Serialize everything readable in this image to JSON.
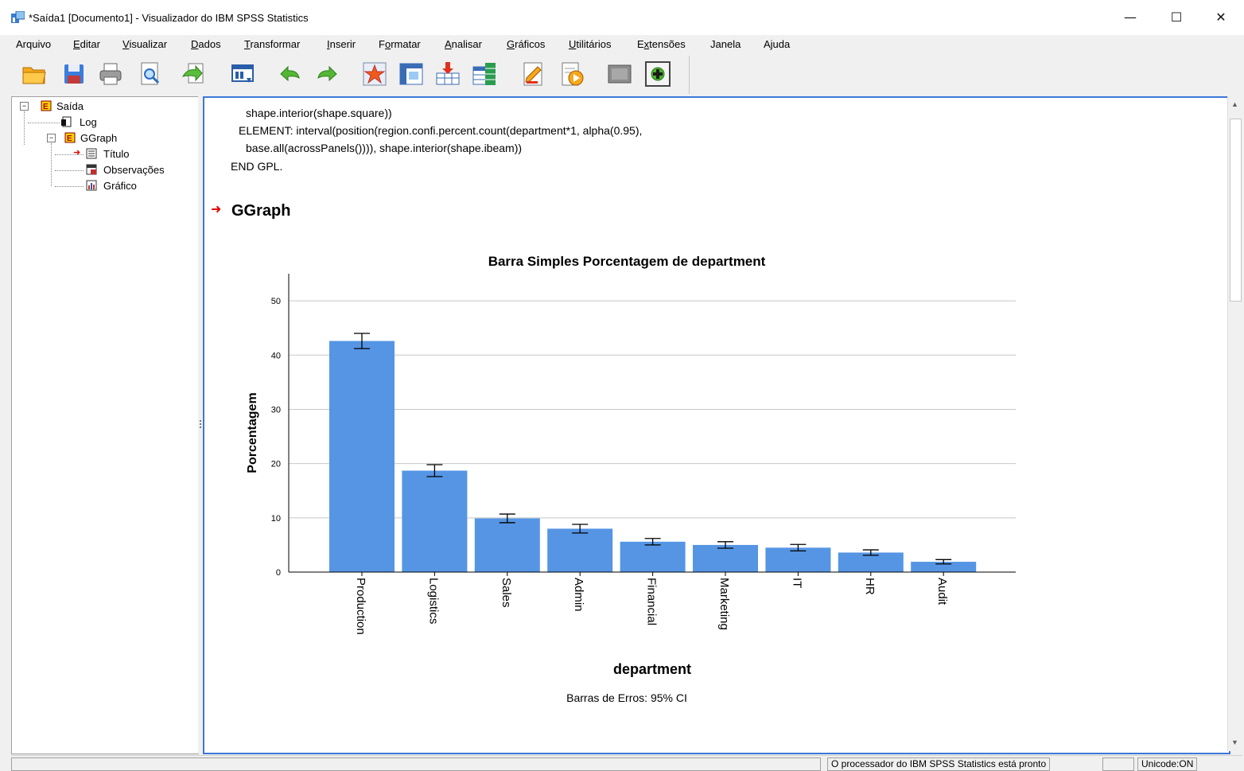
{
  "window": {
    "title": "*Saída1 [Documento1] - Visualizador do IBM SPSS Statistics",
    "minimize_glyph": "—",
    "maximize_glyph": "☐",
    "close_glyph": "✕"
  },
  "menu": [
    {
      "label": "Arquivo",
      "accel": ""
    },
    {
      "label": "Editar",
      "accel": "E"
    },
    {
      "label": "Visualizar",
      "accel": "V"
    },
    {
      "label": "Dados",
      "accel": "D"
    },
    {
      "label": "Transformar",
      "accel": "T"
    },
    {
      "label": "Inserir",
      "accel": "I"
    },
    {
      "label": "Formatar",
      "accel": "o"
    },
    {
      "label": "Analisar",
      "accel": "A"
    },
    {
      "label": "Gráficos",
      "accel": "G"
    },
    {
      "label": "Utilitários",
      "accel": "U"
    },
    {
      "label": "Extensões",
      "accel": "x"
    },
    {
      "label": "Janela",
      "accel": ""
    },
    {
      "label": "Ajuda",
      "accel": ""
    }
  ],
  "toolbar": [
    "open-folder-icon",
    "save-icon",
    "print-icon",
    "print-preview-icon",
    "export-icon",
    "recall-dialog-icon",
    "undo-icon",
    "redo-icon",
    "goto-data-icon",
    "goto-case-icon",
    "goto-variable-icon",
    "variables-icon",
    "designate-window-icon",
    "script-icon",
    "hidden-item-icon",
    "new-item-icon"
  ],
  "outline": {
    "root": "Saída",
    "log": "Log",
    "ggraph": "GGraph",
    "titulo": "Título",
    "observacoes": "Observações",
    "grafico": "Gráfico"
  },
  "content": {
    "syntax_lines": [
      "shape.interior(shape.square))",
      "ELEMENT: interval(position(region.confi.percent.count(department*1, alpha(0.95),",
      "base.all(acrossPanels()))), shape.interior(shape.ibeam))",
      "END GPL."
    ],
    "heading": "GGraph"
  },
  "chart_data": {
    "type": "bar",
    "title": "Barra Simples Porcentagem de department",
    "xlabel": "department",
    "ylabel": "Porcentagem",
    "footnote": "Barras de Erros: 95% CI",
    "categories": [
      "Production",
      "Logistics",
      "Sales",
      "Admin",
      "Financial",
      "Marketing",
      "IT",
      "HR",
      "Audit"
    ],
    "values": [
      42.6,
      18.7,
      9.9,
      8.0,
      5.6,
      5.0,
      4.5,
      3.6,
      1.9
    ],
    "ci_low": [
      41.2,
      17.6,
      9.1,
      7.2,
      5.0,
      4.4,
      3.9,
      3.1,
      1.5
    ],
    "ci_high": [
      44.0,
      19.8,
      10.7,
      8.8,
      6.2,
      5.6,
      5.1,
      4.1,
      2.3
    ],
    "yticks": [
      "0",
      "10",
      "20",
      "30",
      "40",
      "50"
    ],
    "ylim": [
      0,
      55
    ],
    "grid": true,
    "bar_color": "#5595e4"
  },
  "status": {
    "message": "O processador do IBM SPSS Statistics  está pronto",
    "encoding": "Unicode:ON"
  }
}
